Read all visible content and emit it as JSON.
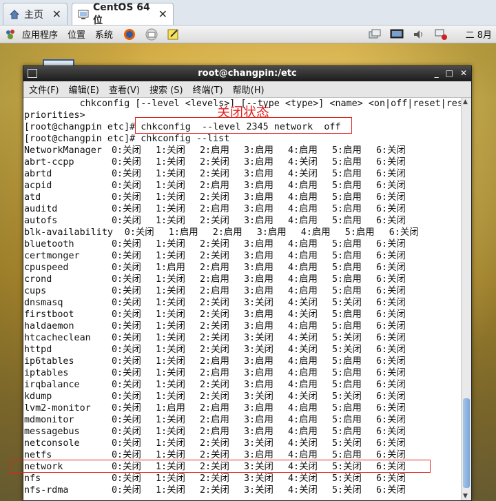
{
  "tabs": [
    {
      "label": "主页"
    },
    {
      "label": "CentOS 64 位"
    }
  ],
  "panel": {
    "menus": [
      "应用程序",
      "位置",
      "系统"
    ],
    "clock": "二 8月"
  },
  "window": {
    "title": "root@changpin:/etc",
    "menu": [
      "文件(F)",
      "编辑(E)",
      "查看(V)",
      "搜索 (S)",
      "终端(T)",
      "帮助(H)"
    ]
  },
  "annotation": "关闭状态",
  "terminal": {
    "usage_line": "          chkconfig [--level <levels>] [--type <type>] <name> <on|off|reset|rese",
    "priorities_line": "priorities>",
    "cmd1": "[root@changpin etc]# chkconfig  --level 2345 network  off",
    "cmd2": "[root@changpin etc]# chkconfig --list",
    "services": [
      {
        "name": "NetworkManager",
        "levels": [
          "0:关闭",
          "1:关闭",
          "2:启用",
          "3:启用",
          "4:启用",
          "5:启用",
          "6:关闭"
        ]
      },
      {
        "name": "abrt-ccpp",
        "levels": [
          "0:关闭",
          "1:关闭",
          "2:关闭",
          "3:启用",
          "4:关闭",
          "5:启用",
          "6:关闭"
        ]
      },
      {
        "name": "abrtd",
        "levels": [
          "0:关闭",
          "1:关闭",
          "2:关闭",
          "3:启用",
          "4:关闭",
          "5:启用",
          "6:关闭"
        ]
      },
      {
        "name": "acpid",
        "levels": [
          "0:关闭",
          "1:关闭",
          "2:启用",
          "3:启用",
          "4:启用",
          "5:启用",
          "6:关闭"
        ]
      },
      {
        "name": "atd",
        "levels": [
          "0:关闭",
          "1:关闭",
          "2:关闭",
          "3:启用",
          "4:启用",
          "5:启用",
          "6:关闭"
        ]
      },
      {
        "name": "auditd",
        "levels": [
          "0:关闭",
          "1:关闭",
          "2:启用",
          "3:启用",
          "4:启用",
          "5:启用",
          "6:关闭"
        ]
      },
      {
        "name": "autofs",
        "levels": [
          "0:关闭",
          "1:关闭",
          "2:关闭",
          "3:启用",
          "4:启用",
          "5:启用",
          "6:关闭"
        ]
      },
      {
        "name": "blk-availability",
        "levels": [
          "0:关闭",
          "1:启用",
          "2:启用",
          "3:启用",
          "4:启用",
          "5:启用",
          "6:关闭"
        ]
      },
      {
        "name": "bluetooth",
        "levels": [
          "0:关闭",
          "1:关闭",
          "2:关闭",
          "3:启用",
          "4:启用",
          "5:启用",
          "6:关闭"
        ]
      },
      {
        "name": "certmonger",
        "levels": [
          "0:关闭",
          "1:关闭",
          "2:关闭",
          "3:启用",
          "4:启用",
          "5:启用",
          "6:关闭"
        ]
      },
      {
        "name": "cpuspeed",
        "levels": [
          "0:关闭",
          "1:启用",
          "2:启用",
          "3:启用",
          "4:启用",
          "5:启用",
          "6:关闭"
        ]
      },
      {
        "name": "crond",
        "levels": [
          "0:关闭",
          "1:关闭",
          "2:启用",
          "3:启用",
          "4:启用",
          "5:启用",
          "6:关闭"
        ]
      },
      {
        "name": "cups",
        "levels": [
          "0:关闭",
          "1:关闭",
          "2:启用",
          "3:启用",
          "4:启用",
          "5:启用",
          "6:关闭"
        ]
      },
      {
        "name": "dnsmasq",
        "levels": [
          "0:关闭",
          "1:关闭",
          "2:关闭",
          "3:关闭",
          "4:关闭",
          "5:关闭",
          "6:关闭"
        ]
      },
      {
        "name": "firstboot",
        "levels": [
          "0:关闭",
          "1:关闭",
          "2:关闭",
          "3:启用",
          "4:关闭",
          "5:启用",
          "6:关闭"
        ]
      },
      {
        "name": "haldaemon",
        "levels": [
          "0:关闭",
          "1:关闭",
          "2:关闭",
          "3:启用",
          "4:启用",
          "5:启用",
          "6:关闭"
        ]
      },
      {
        "name": "htcacheclean",
        "levels": [
          "0:关闭",
          "1:关闭",
          "2:关闭",
          "3:关闭",
          "4:关闭",
          "5:关闭",
          "6:关闭"
        ]
      },
      {
        "name": "httpd",
        "levels": [
          "0:关闭",
          "1:关闭",
          "2:关闭",
          "3:关闭",
          "4:关闭",
          "5:关闭",
          "6:关闭"
        ]
      },
      {
        "name": "ip6tables",
        "levels": [
          "0:关闭",
          "1:关闭",
          "2:启用",
          "3:启用",
          "4:启用",
          "5:启用",
          "6:关闭"
        ]
      },
      {
        "name": "iptables",
        "levels": [
          "0:关闭",
          "1:关闭",
          "2:启用",
          "3:启用",
          "4:启用",
          "5:启用",
          "6:关闭"
        ]
      },
      {
        "name": "irqbalance",
        "levels": [
          "0:关闭",
          "1:关闭",
          "2:关闭",
          "3:启用",
          "4:启用",
          "5:启用",
          "6:关闭"
        ]
      },
      {
        "name": "kdump",
        "levels": [
          "0:关闭",
          "1:关闭",
          "2:关闭",
          "3:关闭",
          "4:关闭",
          "5:关闭",
          "6:关闭"
        ]
      },
      {
        "name": "lvm2-monitor",
        "levels": [
          "0:关闭",
          "1:启用",
          "2:启用",
          "3:启用",
          "4:启用",
          "5:启用",
          "6:关闭"
        ]
      },
      {
        "name": "mdmonitor",
        "levels": [
          "0:关闭",
          "1:关闭",
          "2:启用",
          "3:启用",
          "4:启用",
          "5:启用",
          "6:关闭"
        ]
      },
      {
        "name": "messagebus",
        "levels": [
          "0:关闭",
          "1:关闭",
          "2:启用",
          "3:启用",
          "4:启用",
          "5:启用",
          "6:关闭"
        ]
      },
      {
        "name": "netconsole",
        "levels": [
          "0:关闭",
          "1:关闭",
          "2:关闭",
          "3:关闭",
          "4:关闭",
          "5:关闭",
          "6:关闭"
        ]
      },
      {
        "name": "netfs",
        "levels": [
          "0:关闭",
          "1:关闭",
          "2:关闭",
          "3:启用",
          "4:启用",
          "5:启用",
          "6:关闭"
        ]
      },
      {
        "name": "network",
        "levels": [
          "0:关闭",
          "1:关闭",
          "2:关闭",
          "3:关闭",
          "4:关闭",
          "5:关闭",
          "6:关闭"
        ]
      },
      {
        "name": "nfs",
        "levels": [
          "0:关闭",
          "1:关闭",
          "2:关闭",
          "3:关闭",
          "4:关闭",
          "5:关闭",
          "6:关闭"
        ]
      },
      {
        "name": "nfs-rdma",
        "levels": [
          "0:关闭",
          "1:关闭",
          "2:关闭",
          "3:关闭",
          "4:关闭",
          "5:关闭",
          "6:关闭"
        ]
      }
    ]
  }
}
